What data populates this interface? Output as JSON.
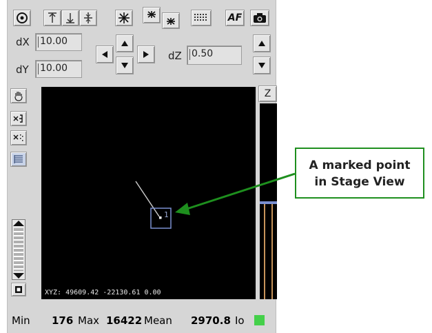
{
  "toolbar": {
    "icons": [
      "target-icon",
      "align-top-icon",
      "align-bottom-icon",
      "align-center-icon",
      "star-icon",
      "star-top-icon",
      "star-bottom-icon",
      "grid-icon",
      "autofocus-button",
      "camera-icon"
    ],
    "af_label": "AF"
  },
  "xy": {
    "dx_label": "dX",
    "dx_value": "10.00",
    "dy_label": "dY",
    "dy_value": "10.00"
  },
  "z": {
    "dz_label": "dZ",
    "dz_value": "0.50",
    "tab_label": "Z"
  },
  "stage_view": {
    "point_label": "1",
    "xyz_readout": "XYZ: 49609.42 -22130.61 0.00"
  },
  "status": {
    "min_label": "Min",
    "min_value": "176",
    "max_label": "Max",
    "max_value": "16422",
    "mean_label": "Mean",
    "mean_value": "2970.8",
    "io_label": "Io",
    "io_color": "#44d04a"
  },
  "callout": {
    "line1": "A marked point",
    "line2": "in Stage View",
    "color": "#1e8f1e"
  }
}
